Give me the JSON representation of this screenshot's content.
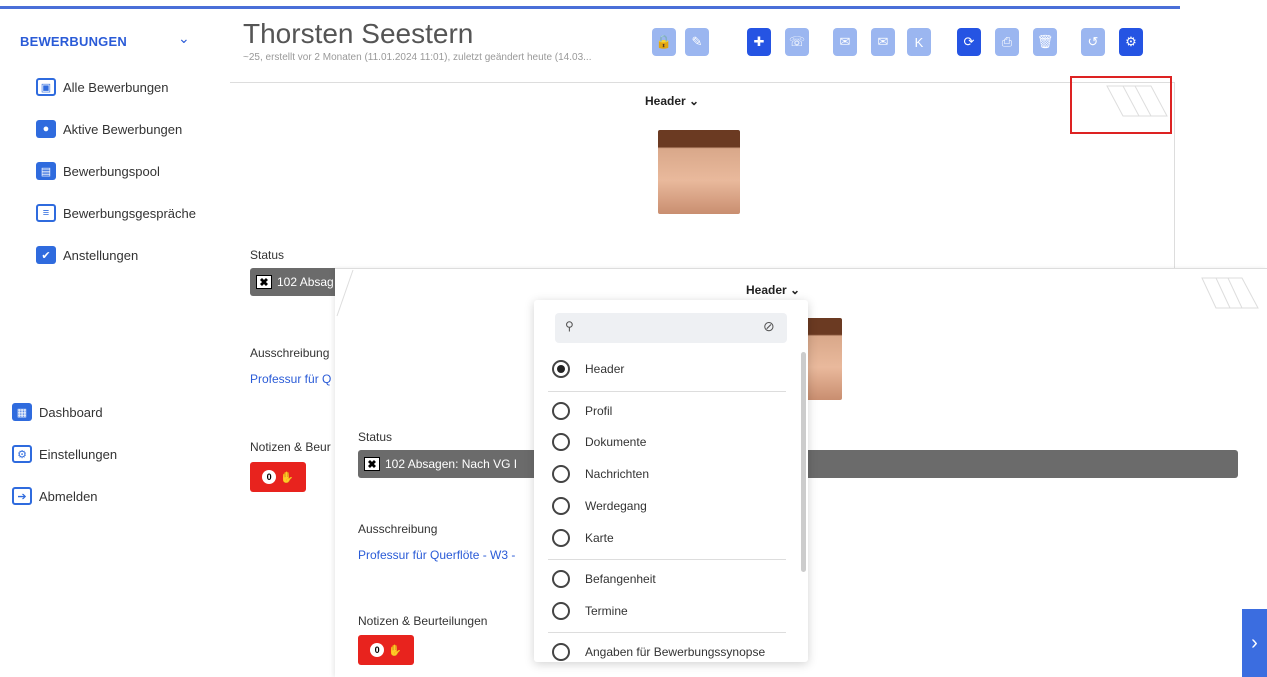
{
  "sidebar": {
    "section_title": "BEWERBUNGEN",
    "items": [
      {
        "label": "Alle Bewerbungen",
        "icon": "id-card-icon"
      },
      {
        "label": "Aktive Bewerbungen",
        "icon": "people-check-icon"
      },
      {
        "label": "Bewerbungspool",
        "icon": "drawer-icon"
      },
      {
        "label": "Bewerbungsgespräche",
        "icon": "chat-list-icon"
      },
      {
        "label": "Anstellungen",
        "icon": "checkbox-icon"
      }
    ],
    "bottom": [
      {
        "label": "Dashboard",
        "icon": "dashboard-icon"
      },
      {
        "label": "Einstellungen",
        "icon": "gear-icon"
      },
      {
        "label": "Abmelden",
        "icon": "logout-icon"
      }
    ]
  },
  "header": {
    "name": "Thorsten Seestern",
    "subline": "~25, erstellt vor 2 Monaten (11.01.2024 11:01), zuletzt geändert heute (14.03..."
  },
  "back_panel": {
    "tab_label": "Header",
    "status_label": "Status",
    "status_value": "102 Absag",
    "ausschreibung_label": "Ausschreibung",
    "ausschreibung_value": "Professur für Q",
    "notes_label": "Notizen & Beur",
    "notes_count": "0"
  },
  "front_panel": {
    "tab_label": "Header",
    "status_label": "Status",
    "status_value": "102 Absagen: Nach VG I",
    "ausschreibung_label": "Ausschreibung",
    "ausschreibung_value": "Professur für Querflöte - W3 -",
    "notes_label": "Notizen & Beurteilungen",
    "notes_count": "0"
  },
  "dropdown": {
    "search_placeholder": "",
    "selected": "Header",
    "options": [
      "Header",
      "Profil",
      "Dokumente",
      "Nachrichten",
      "Werdegang",
      "Karte",
      "Befangenheit",
      "Termine",
      "Angaben für Bewerbungssynopse"
    ]
  },
  "colors": {
    "accent": "#2554e3",
    "accent_light": "#9bb6f0",
    "status_bar": "#6b6b6b",
    "notes_red": "#e8231e",
    "highlight_red": "#d22222"
  }
}
